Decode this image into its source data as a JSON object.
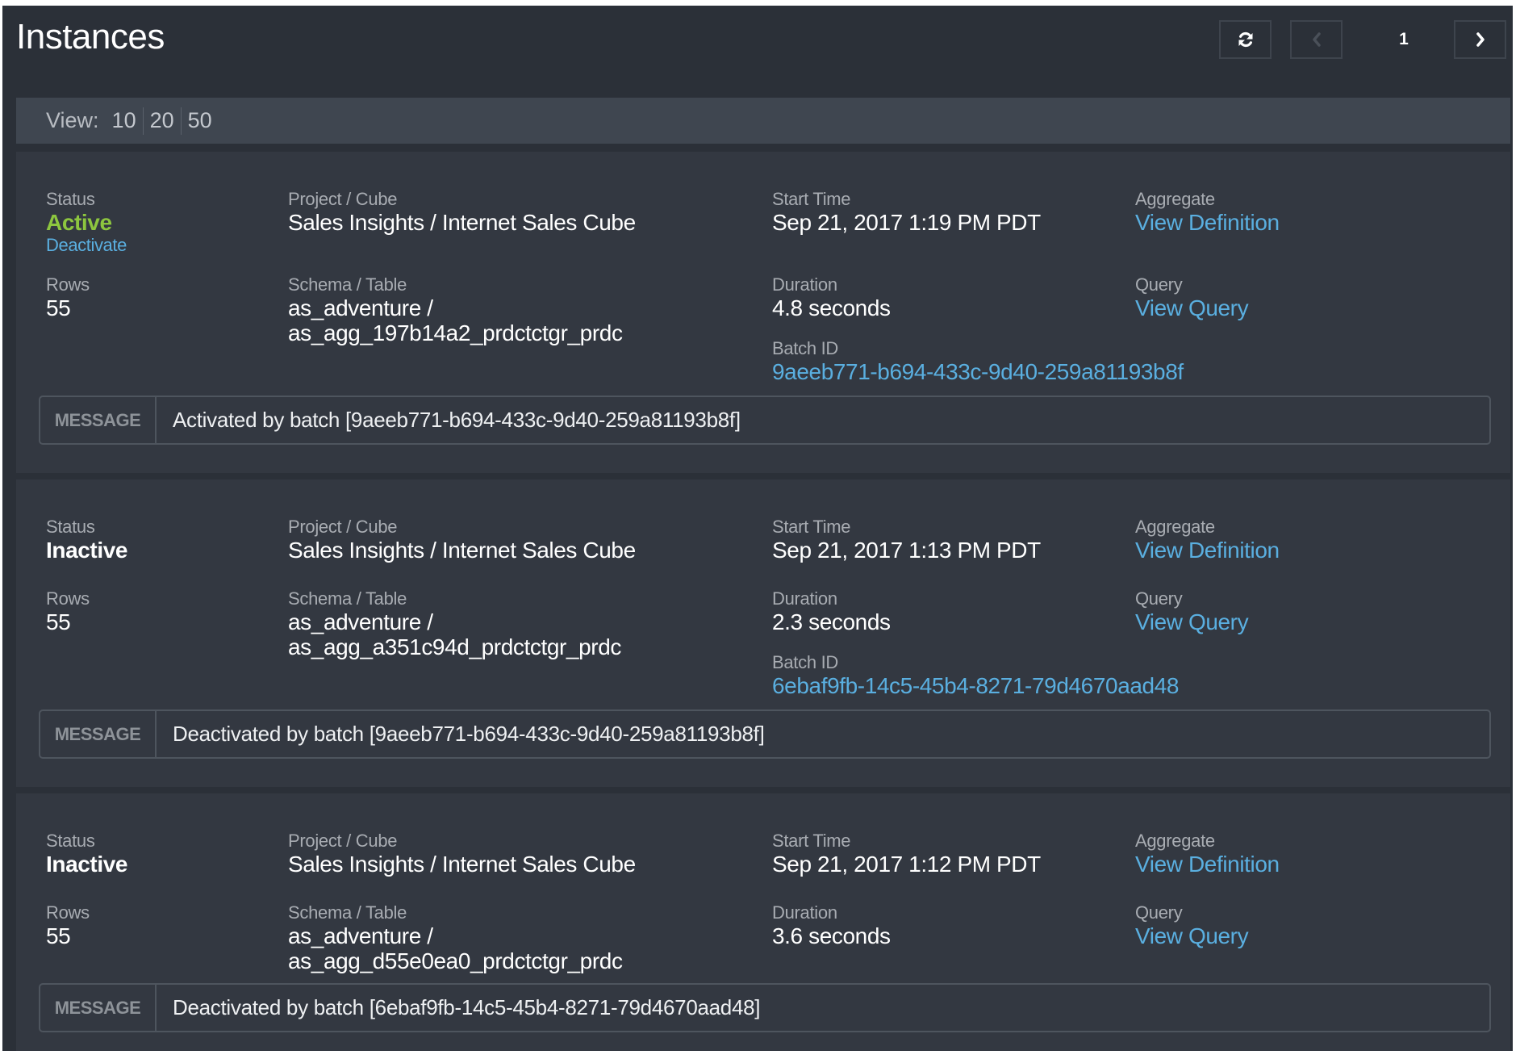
{
  "header": {
    "title": "Instances",
    "refresh_icon": "refresh-icon",
    "prev_icon": "chevron-left-icon",
    "next_icon": "chevron-right-icon",
    "current_page": "1"
  },
  "view": {
    "label": "View:",
    "options": [
      "10",
      "20",
      "50"
    ]
  },
  "labels": {
    "status": "Status",
    "rows": "Rows",
    "project_cube": "Project / Cube",
    "schema_table": "Schema / Table",
    "start_time": "Start Time",
    "duration": "Duration",
    "batch_id": "Batch ID",
    "aggregate": "Aggregate",
    "query": "Query",
    "message": "MESSAGE"
  },
  "colors": {
    "active": "#8dc63f",
    "link": "#5aafe0",
    "background": "#2b3038",
    "card": "#333841"
  },
  "instances": [
    {
      "status": "Active",
      "action": "Deactivate",
      "rows": "55",
      "project_cube": "Sales Insights / Internet Sales Cube",
      "schema": "as_adventure /",
      "table": "as_agg_197b14a2_prdctctgr_prdc",
      "start_time": "Sep 21, 2017 1:19 PM PDT",
      "duration": "4.8 seconds",
      "batch_id": "9aeeb771-b694-433c-9d40-259a81193b8f",
      "aggregate_link": "View Definition",
      "query_link": "View Query",
      "message": "Activated by batch [9aeeb771-b694-433c-9d40-259a81193b8f]"
    },
    {
      "status": "Inactive",
      "rows": "55",
      "project_cube": "Sales Insights / Internet Sales Cube",
      "schema": "as_adventure /",
      "table": "as_agg_a351c94d_prdctctgr_prdc",
      "start_time": "Sep 21, 2017 1:13 PM PDT",
      "duration": "2.3 seconds",
      "batch_id": "6ebaf9fb-14c5-45b4-8271-79d4670aad48",
      "aggregate_link": "View Definition",
      "query_link": "View Query",
      "message": "Deactivated by batch [9aeeb771-b694-433c-9d40-259a81193b8f]"
    },
    {
      "status": "Inactive",
      "rows": "55",
      "project_cube": "Sales Insights / Internet Sales Cube",
      "schema": "as_adventure /",
      "table": "as_agg_d55e0ea0_prdctctgr_prdc",
      "start_time": "Sep 21, 2017 1:12 PM PDT",
      "duration": "3.6 seconds",
      "aggregate_link": "View Definition",
      "query_link": "View Query",
      "message": "Deactivated by batch [6ebaf9fb-14c5-45b4-8271-79d4670aad48]"
    }
  ]
}
